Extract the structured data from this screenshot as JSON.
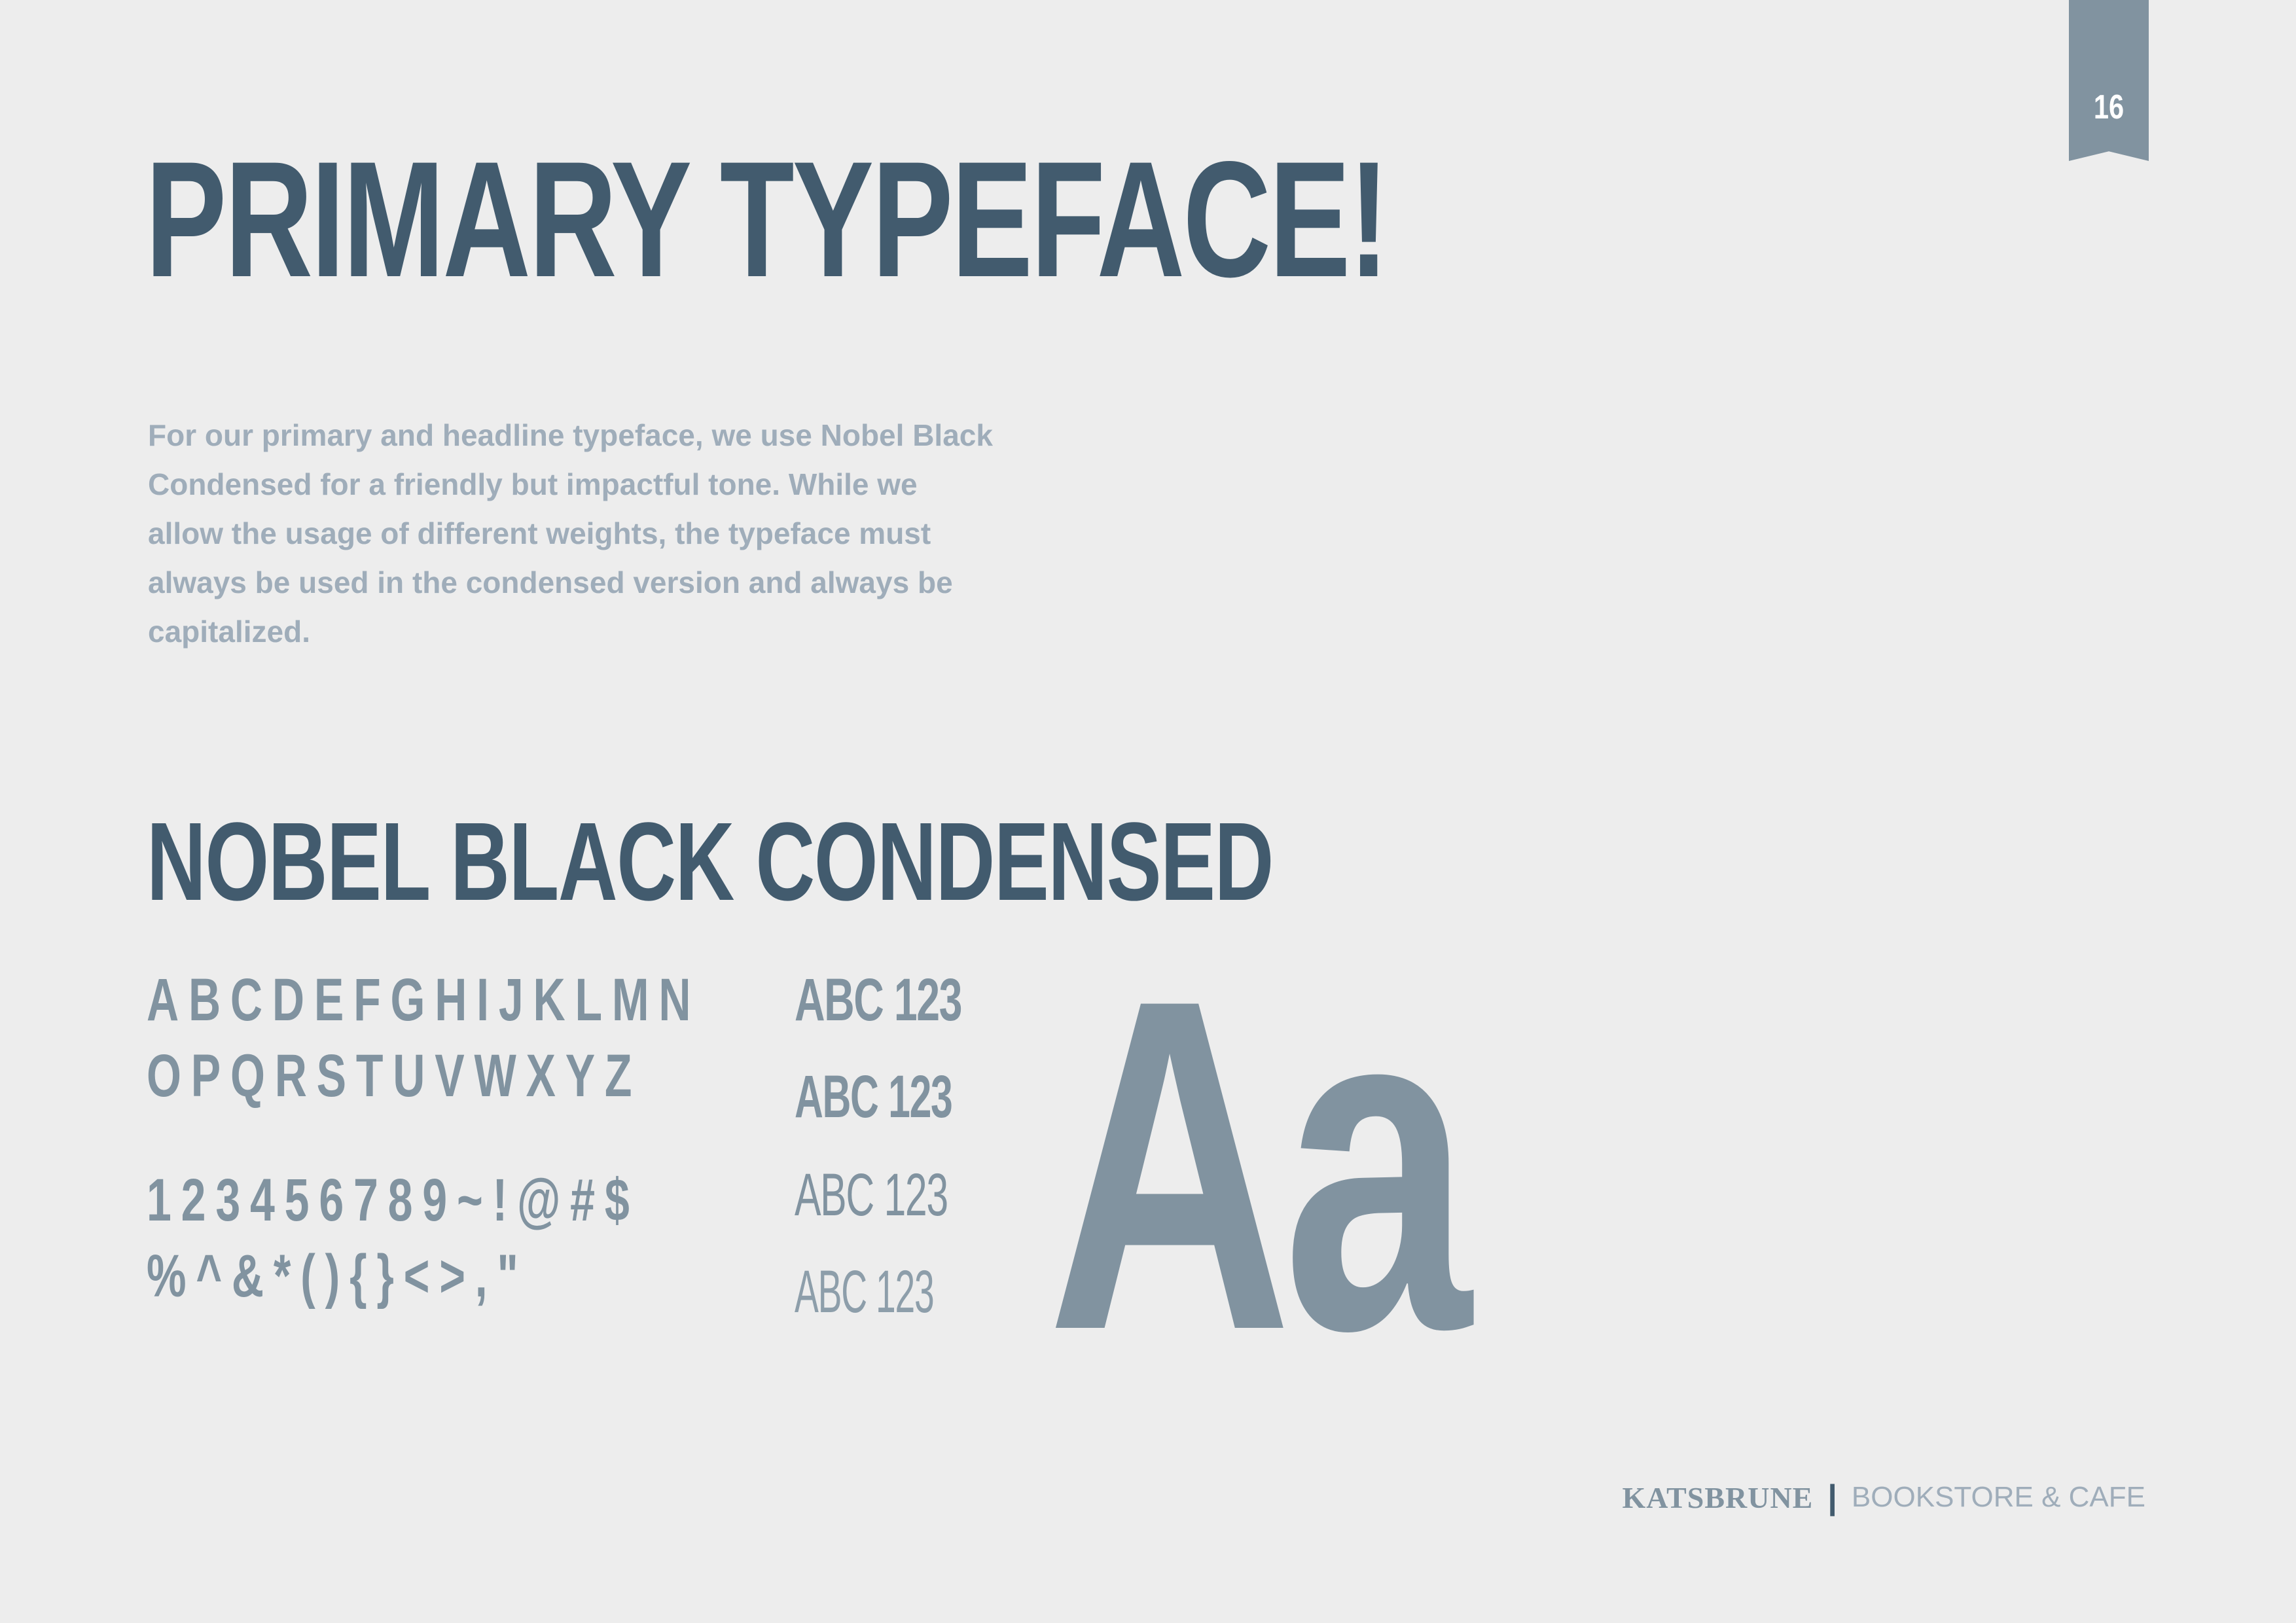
{
  "page": {
    "number": "16",
    "title": "PRIMARY TYPEFACE!",
    "intro": "For our primary and headline typeface, we use Nobel Black Condensed for a friendly but impactful tone. While we allow the usage of different weights, the typeface must always be used in the condensed version and always be capitalized."
  },
  "typeface": {
    "name": "NOBEL BLACK CONDENSED",
    "glyph_lines": [
      "ABCDEFGHIJKLMN",
      "OPQRSTUVWXYZ",
      "123456789~!@#$",
      "%^&*(){}<>,\""
    ],
    "weight_samples": [
      "ABC 123",
      "ABC 123",
      "ABC 123",
      "ABC 123"
    ],
    "specimen": "Aa"
  },
  "footer": {
    "brand": "KATSBRUNE",
    "separator": "|",
    "tagline": "BOOKSTORE & CAFE"
  },
  "colors": {
    "background": "#ededed",
    "heading": "#425b6e",
    "accent": "#8193a0",
    "body_text": "#9fadba"
  }
}
